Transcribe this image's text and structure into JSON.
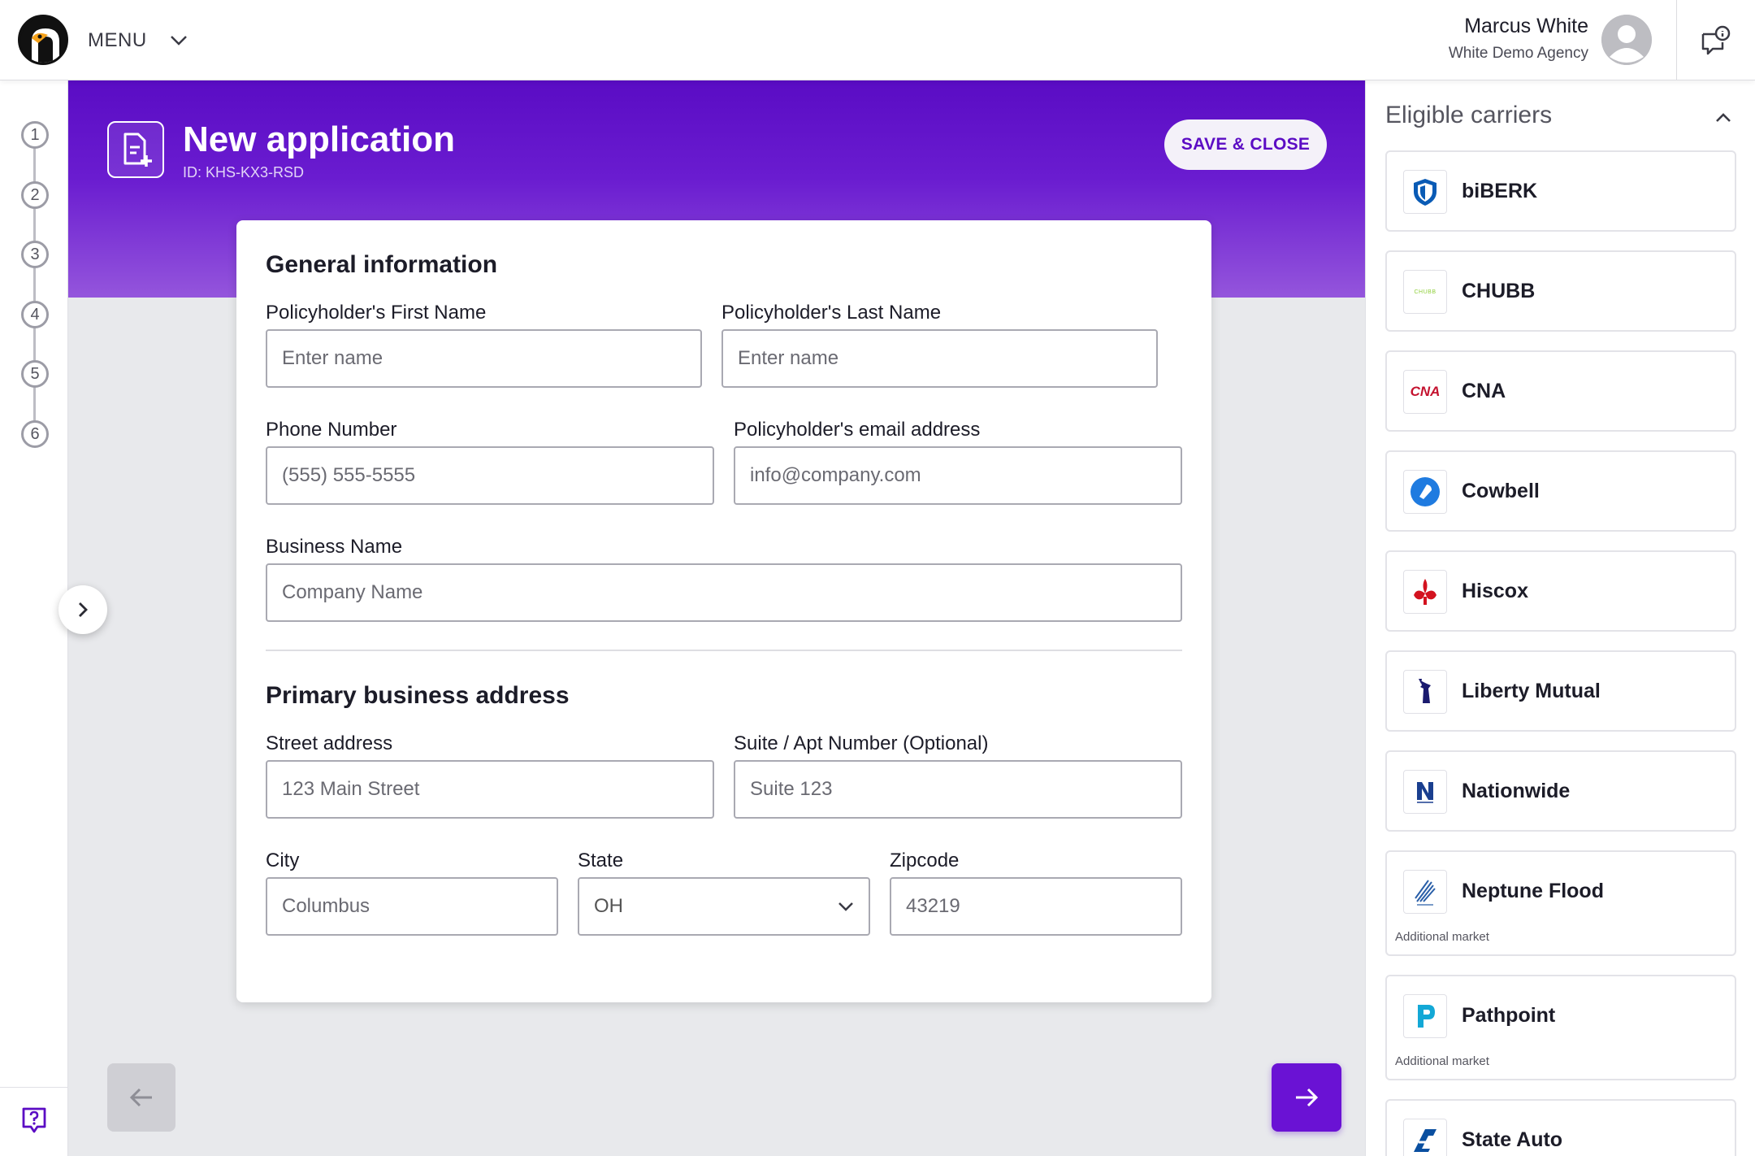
{
  "header": {
    "menu_label": "MENU",
    "user_name": "Marcus White",
    "user_agency": "White Demo Agency"
  },
  "stepper": {
    "steps": [
      "1",
      "2",
      "3",
      "4",
      "5",
      "6"
    ]
  },
  "hero": {
    "title": "New application",
    "id_text": "ID: KHS-KX3-RSD",
    "save_label": "SAVE & CLOSE"
  },
  "form": {
    "general_title": "General information",
    "first_name_label": "Policyholder's First Name",
    "first_name_placeholder": "Enter name",
    "last_name_label": "Policyholder's Last Name",
    "last_name_placeholder": "Enter name",
    "phone_label": "Phone Number",
    "phone_placeholder": "(555) 555-5555",
    "email_label": "Policyholder's email address",
    "email_placeholder": "info@company.com",
    "business_label": "Business Name",
    "business_placeholder": "Company Name",
    "address_title": "Primary business address",
    "street_label": "Street address",
    "street_placeholder": "123 Main Street",
    "suite_label": "Suite / Apt Number (Optional)",
    "suite_placeholder": "Suite 123",
    "city_label": "City",
    "city_placeholder": "Columbus",
    "state_label": "State",
    "state_value": "OH",
    "zip_label": "Zipcode",
    "zip_placeholder": "43219"
  },
  "carriers": {
    "title": "Eligible carriers",
    "items": [
      {
        "name": "biBERK",
        "logo": "biberk-shield-icon",
        "note": ""
      },
      {
        "name": "CHUBB",
        "logo": "chubb-logo",
        "note": "",
        "logo_text": "CHUBB"
      },
      {
        "name": "CNA",
        "logo": "cna-logo",
        "note": "",
        "logo_text": "CNA"
      },
      {
        "name": "Cowbell",
        "logo": "cowbell-icon",
        "note": ""
      },
      {
        "name": "Hiscox",
        "logo": "hiscox-fleur-icon",
        "note": ""
      },
      {
        "name": "Liberty Mutual",
        "logo": "liberty-statue-icon",
        "note": ""
      },
      {
        "name": "Nationwide",
        "logo": "nationwide-logo",
        "note": ""
      },
      {
        "name": "Neptune Flood",
        "logo": "neptune-trident-icon",
        "note": "Additional market"
      },
      {
        "name": "Pathpoint",
        "logo": "pathpoint-p-icon",
        "note": "Additional market"
      },
      {
        "name": "State Auto",
        "logo": "state-auto-icon",
        "note": ""
      }
    ]
  },
  "colors": {
    "brand_purple": "#5b0cc4",
    "next_button": "#6a12d4",
    "back_button_disabled": "#cfcfd4"
  }
}
